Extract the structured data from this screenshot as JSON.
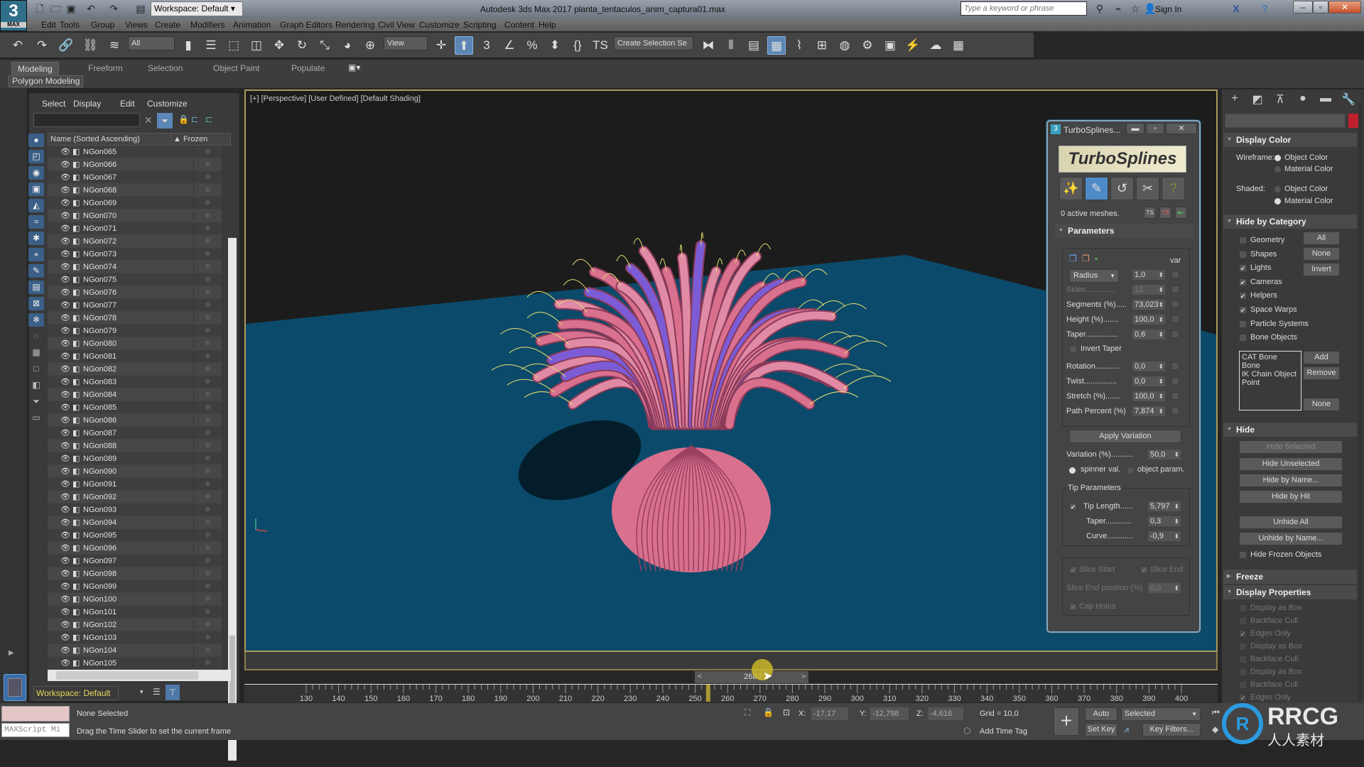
{
  "app": {
    "logo_text": "3",
    "logo_sub": "MAX",
    "workspace": "Workspace: Default",
    "title": "Autodesk 3ds Max 2017     planta_tentaculos_anim_captura01.max",
    "search_placeholder": "Type a keyword or phrase",
    "sign_in": "Sign In"
  },
  "menu": [
    "Edit",
    "Tools",
    "Group",
    "Views",
    "Create",
    "Modifiers",
    "Animation",
    "Graph Editors",
    "Rendering",
    "Civil View",
    "Customize",
    "Scripting",
    "Content",
    "Help"
  ],
  "toolbar": {
    "selection_filter": "All",
    "ref_coord": "View",
    "named_selection": "Create Selection Se",
    "icons": [
      "undo-icon",
      "redo-icon",
      "link-icon",
      "unlink-icon",
      "bind-space-warp-icon",
      "select-object-icon",
      "select-by-name-icon",
      "rect-region-icon",
      "window-crossing-icon",
      "move-icon",
      "rotate-icon",
      "scale-icon",
      "place-icon",
      "use-pivot-icon",
      "select-manipulate-icon",
      "keyboard-shortcut-icon",
      "snap-3d-icon",
      "angle-snap-icon",
      "percent-snap-icon",
      "spinner-snap-icon",
      "edit-named-sets-icon",
      "turbosplines-icon",
      "mirror-icon",
      "align-icon",
      "layer-explorer-icon",
      "toggle-ribbon-icon",
      "curve-editor-icon",
      "schematic-view-icon",
      "material-editor-icon",
      "render-setup-icon",
      "rendered-frame-icon",
      "render-production-icon",
      "render-cloud-icon",
      "viewport-layout-icon"
    ]
  },
  "ribbon": {
    "tabs": [
      "Modeling",
      "Freeform",
      "Selection",
      "Object Paint",
      "Populate"
    ],
    "active_tab": "Modeling",
    "panel": "Polygon Modeling"
  },
  "scene_explorer": {
    "menu": [
      "Select",
      "Display",
      "Edit",
      "Customize"
    ],
    "col_name": "Name (Sorted Ascending)",
    "col_frozen": "Frozen",
    "rows": [
      "NGon065",
      "NGon066",
      "NGon067",
      "NGon068",
      "NGon069",
      "NGon070",
      "NGon071",
      "NGon072",
      "NGon073",
      "NGon074",
      "NGon075",
      "NGon076",
      "NGon077",
      "NGon078",
      "NGon079",
      "NGon080",
      "NGon081",
      "NGon082",
      "NGon083",
      "NGon084",
      "NGon085",
      "NGon086",
      "NGon087",
      "NGon088",
      "NGon089",
      "NGon090",
      "NGon091",
      "NGon092",
      "NGon093",
      "NGon094",
      "NGon095",
      "NGon096",
      "NGon097",
      "NGon098",
      "NGon099",
      "NGon100",
      "NGon101",
      "NGon102",
      "NGon103",
      "NGon104",
      "NGon105"
    ],
    "workspace": "Workspace: Default"
  },
  "viewport": {
    "label": "[+] [Perspective] [User Defined] [Default Shading]",
    "plane_color": "#0b4a6a",
    "creature_color": "#d8708e"
  },
  "turbosplines": {
    "title": "TurboSplines...",
    "logo_text": "TurboSplines",
    "active_meshes": "0 active meshes.",
    "parameters_header": "Parameters",
    "var_label": "var",
    "radius_dropdown": "Radius",
    "params": [
      {
        "label": "",
        "value": "1,0",
        "dim": false
      },
      {
        "label": "Sides..............",
        "value": "12",
        "dim": true
      },
      {
        "label": "Segments (%).....",
        "value": "73,023",
        "dim": false
      },
      {
        "label": "Height (%).......",
        "value": "100,0",
        "dim": false
      },
      {
        "label": "Taper...............",
        "value": "0,6",
        "dim": false
      }
    ],
    "invert_taper": "Invert Taper",
    "params2": [
      {
        "label": "Rotation...........",
        "value": "0,0"
      },
      {
        "label": "Twist...............",
        "value": "0,0"
      },
      {
        "label": "Stretch (%).......",
        "value": "100,0"
      },
      {
        "label": "Path Percent (%)",
        "value": "7,874"
      }
    ],
    "apply_variation": "Apply Variation",
    "variation_label": "Variation (%)..........",
    "variation_value": "50,0",
    "spinner_val": "spinner val.",
    "object_param": "object param.",
    "tip_header": "Tip Parameters",
    "tip": [
      {
        "label": "Tip Length......",
        "value": "5,797"
      },
      {
        "label": "Taper............",
        "value": "0,3"
      },
      {
        "label": "Curve............",
        "value": "-0,9"
      }
    ],
    "slice_start": "Slice Start",
    "slice_end": "Slice End",
    "slice_end_pos": "Slice End position (%)",
    "slice_end_value": "0,0",
    "cap_holes": "Cap Holes"
  },
  "command_panel": {
    "tabs": [
      "create-icon",
      "modify-icon",
      "hierarchy-icon",
      "motion-icon",
      "display-icon",
      "utilities-icon"
    ],
    "color_swatch": "#c0202c",
    "display_color": {
      "header": "Display Color",
      "wireframe": "Wireframe:",
      "shaded": "Shaded:",
      "object_color": "Object Color",
      "material_color": "Material Color"
    },
    "hide_by_category": {
      "header": "Hide by Category",
      "items": [
        {
          "label": "Geometry",
          "checked": false
        },
        {
          "label": "Shapes",
          "checked": false
        },
        {
          "label": "Lights",
          "checked": true
        },
        {
          "label": "Cameras",
          "checked": true
        },
        {
          "label": "Helpers",
          "checked": true
        },
        {
          "label": "Space Warps",
          "checked": true
        },
        {
          "label": "Particle Systems",
          "checked": false
        },
        {
          "label": "Bone Objects",
          "checked": false
        }
      ],
      "buttons": [
        "All",
        "None",
        "Invert"
      ],
      "list": [
        "CAT Bone",
        "Bone",
        "IK Chain Object",
        "Point"
      ],
      "add": "Add",
      "remove": "Remove",
      "none": "None"
    },
    "hide": {
      "header": "Hide",
      "buttons": [
        "Hide Selected",
        "Hide Unselected",
        "Hide by Name...",
        "Hide by Hit",
        "Unhide All",
        "Unhide by Name..."
      ],
      "hide_frozen": "Hide Frozen Objects"
    },
    "freeze_header": "Freeze",
    "display_properties": {
      "header": "Display Properties",
      "items": [
        {
          "label": "Display as Box",
          "checked": false
        },
        {
          "label": "Backface Cull",
          "checked": false
        },
        {
          "label": "Edges Only",
          "checked": true
        },
        {
          "label": "Display as Box",
          "checked": false
        },
        {
          "label": "Backface Cull",
          "checked": false
        },
        {
          "label": "Display as Box",
          "checked": false
        },
        {
          "label": "Backface Cull",
          "checked": false
        },
        {
          "label": "Edges Only",
          "checked": true
        }
      ]
    }
  },
  "timeline": {
    "slider_text": "268 / 2",
    "current_frame": 268,
    "marker_frame": 254,
    "tick_labels": [
      "130",
      "140",
      "150",
      "160",
      "170",
      "180",
      "190",
      "200",
      "210",
      "220",
      "230",
      "240",
      "250",
      "260",
      "270",
      "280",
      "290",
      "300",
      "310",
      "320",
      "330",
      "340",
      "350",
      "360",
      "370",
      "380",
      "390",
      "400"
    ]
  },
  "status": {
    "maxscript": "MAXScript Mi",
    "selection": "None Selected",
    "prompt": "Drag the Time Slider to set the current frame",
    "x_label": "X:",
    "x": "-17,17",
    "y_label": "Y:",
    "y": "-12,798",
    "z_label": "Z:",
    "z": "-4,616",
    "grid": "Grid = 10,0",
    "add_time_tag": "Add Time Tag",
    "auto_key": "Auto Key",
    "set_key": "Set Key",
    "key_mode": "Selected",
    "key_filters": "Key Filters..."
  },
  "watermark": {
    "text": "RRCG",
    "sub": "人人素材"
  }
}
